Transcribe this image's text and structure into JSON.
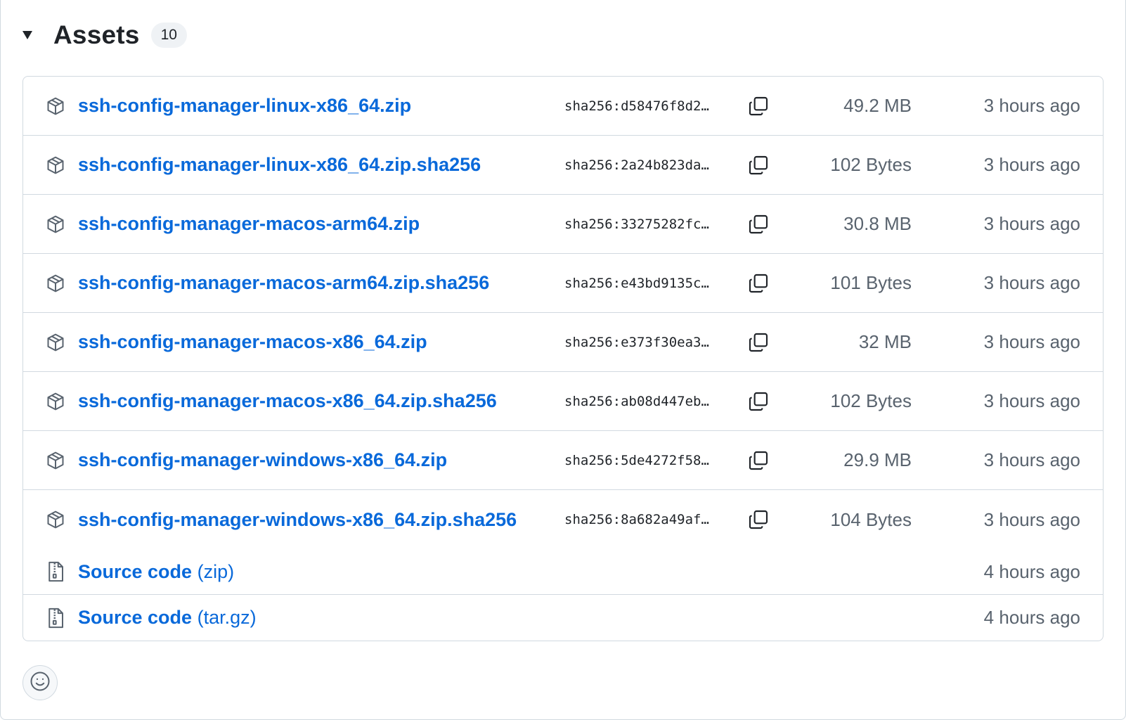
{
  "header": {
    "title": "Assets",
    "count": "10"
  },
  "assets": [
    {
      "name": "ssh-config-manager-linux-x86_64.zip",
      "sha": "sha256:d58476f8d2…",
      "size": "49.2 MB",
      "time": "3 hours ago"
    },
    {
      "name": "ssh-config-manager-linux-x86_64.zip.sha256",
      "sha": "sha256:2a24b823da…",
      "size": "102 Bytes",
      "time": "3 hours ago"
    },
    {
      "name": "ssh-config-manager-macos-arm64.zip",
      "sha": "sha256:33275282fc…",
      "size": "30.8 MB",
      "time": "3 hours ago"
    },
    {
      "name": "ssh-config-manager-macos-arm64.zip.sha256",
      "sha": "sha256:e43bd9135c…",
      "size": "101 Bytes",
      "time": "3 hours ago"
    },
    {
      "name": "ssh-config-manager-macos-x86_64.zip",
      "sha": "sha256:e373f30ea3…",
      "size": "32 MB",
      "time": "3 hours ago"
    },
    {
      "name": "ssh-config-manager-macos-x86_64.zip.sha256",
      "sha": "sha256:ab08d447eb…",
      "size": "102 Bytes",
      "time": "3 hours ago"
    },
    {
      "name": "ssh-config-manager-windows-x86_64.zip",
      "sha": "sha256:5de4272f58…",
      "size": "29.9 MB",
      "time": "3 hours ago"
    },
    {
      "name": "ssh-config-manager-windows-x86_64.zip.sha256",
      "sha": "sha256:8a682a49af…",
      "size": "104 Bytes",
      "time": "3 hours ago"
    }
  ],
  "source": [
    {
      "label": "Source code",
      "format": "(zip)",
      "time": "4 hours ago"
    },
    {
      "label": "Source code",
      "format": "(tar.gz)",
      "time": "4 hours ago"
    }
  ],
  "icons": {
    "asset": "package-icon",
    "source": "file-zip-icon",
    "copy": "copy-icon",
    "reaction": "smiley-icon",
    "toggle": "triangle-down-icon"
  },
  "colors": {
    "link": "#0969da",
    "muted": "#59636e",
    "border": "#d1d9e0"
  }
}
